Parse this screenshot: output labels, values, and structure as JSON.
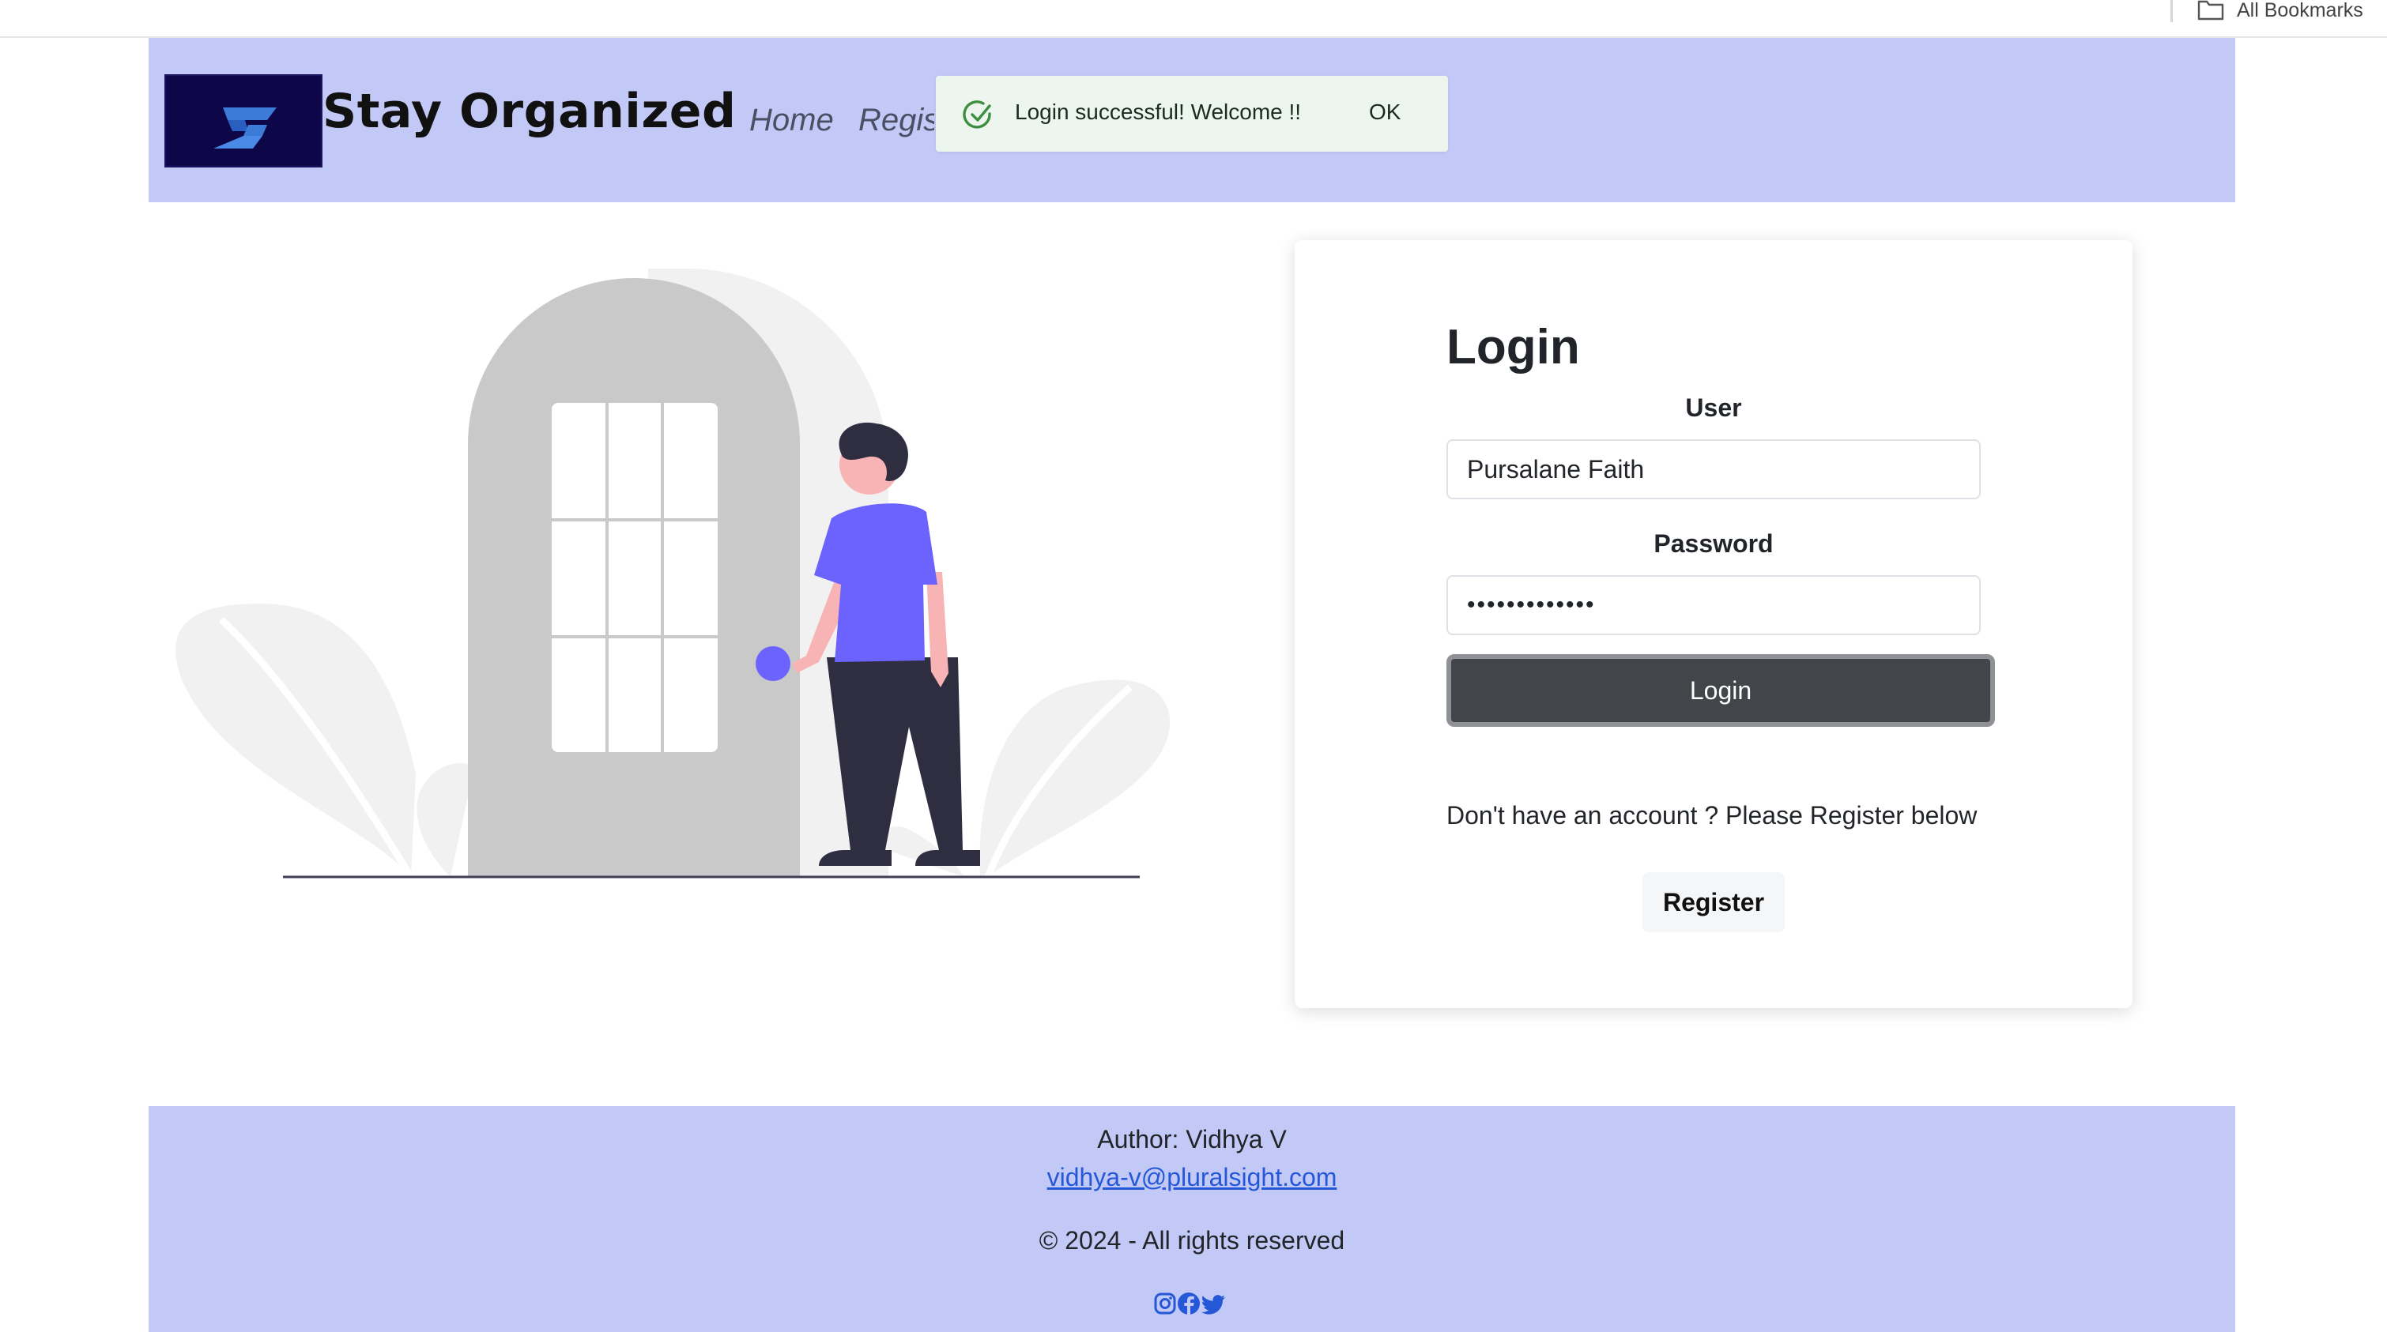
{
  "browser": {
    "bookmarks_label": "All Bookmarks"
  },
  "header": {
    "brand": "Stay Organized",
    "nav": {
      "home": "Home",
      "register": "Register"
    }
  },
  "toast": {
    "message": "Login successful! Welcome !!",
    "ok_label": "OK"
  },
  "login": {
    "title": "Login",
    "user_label": "User",
    "user_value": "Pursalane Faith",
    "password_label": "Password",
    "password_value": "•••••••••••••",
    "login_button": "Login",
    "register_prompt": "Don't have an account ? Please Register below",
    "register_button": "Register"
  },
  "footer": {
    "author": "Author: Vidhya V",
    "email": "vidhya-v@pluralsight.com",
    "copyright": "© 2024 - All rights reserved",
    "social_icons": [
      "instagram-icon",
      "facebook-icon",
      "twitter-icon"
    ]
  },
  "colors": {
    "header_bg": "#c3c9f6",
    "footer_bg": "#c3c9f6",
    "logo_bg": "#0d0649",
    "accent_purple": "#6c63ff",
    "login_button_bg": "#42454a",
    "toast_bg": "#edf6ee",
    "link_blue": "#2458d6"
  }
}
